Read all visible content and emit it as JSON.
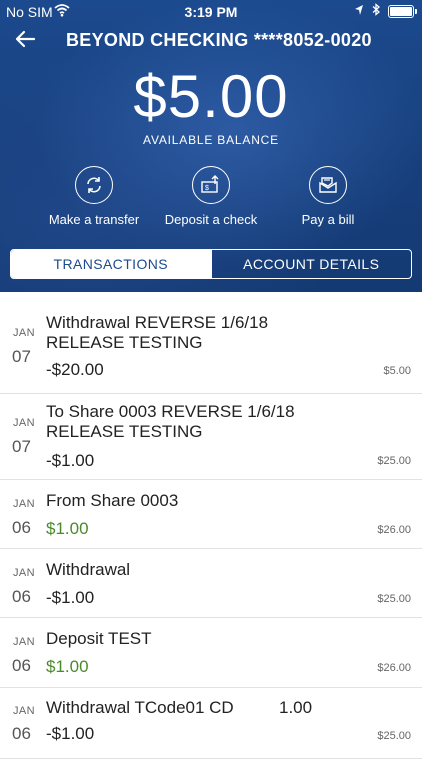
{
  "status": {
    "carrier": "No SIM",
    "time": "3:19 PM"
  },
  "header": {
    "account_title": "BEYOND CHECKING ****8052-0020",
    "balance": "$5.00",
    "balance_label": "AVAILABLE BALANCE"
  },
  "actions": [
    {
      "label": "Make a transfer",
      "icon": "transfer-icon"
    },
    {
      "label": "Deposit a check",
      "icon": "deposit-check-icon"
    },
    {
      "label": "Pay a bill",
      "icon": "bill-icon"
    }
  ],
  "tabs": {
    "transactions": "TRANSACTIONS",
    "account_details": "ACCOUNT DETAILS",
    "active": "transactions"
  },
  "transactions": [
    {
      "month": "JAN",
      "day": "07",
      "line1": "Withdrawal REVERSE 1/6/18",
      "line2": "RELEASE TESTING",
      "amount": "-$20.00",
      "positive": false,
      "balance": "$5.00"
    },
    {
      "month": "JAN",
      "day": "07",
      "line1": "To Share 0003 REVERSE 1/6/18",
      "line2": "RELEASE TESTING",
      "amount": "-$1.00",
      "positive": false,
      "balance": "$25.00"
    },
    {
      "month": "JAN",
      "day": "06",
      "line1": "From Share 0003",
      "line2": "",
      "amount": "$1.00",
      "positive": true,
      "balance": "$26.00"
    },
    {
      "month": "JAN",
      "day": "06",
      "line1": "Withdrawal",
      "line2": "",
      "amount": "-$1.00",
      "positive": false,
      "balance": "$25.00"
    },
    {
      "month": "JAN",
      "day": "06",
      "line1": "Deposit TEST",
      "line2": "",
      "amount": "$1.00",
      "positive": true,
      "balance": "$26.00"
    },
    {
      "month": "JAN",
      "day": "06",
      "line1": "Withdrawal TCode01 CD",
      "line2": "",
      "extra": "1.00",
      "amount": "-$1.00",
      "positive": false,
      "balance": "$25.00"
    }
  ],
  "colors": {
    "header_blue": "#1c4a8e",
    "positive_green": "#4a8a2a"
  }
}
